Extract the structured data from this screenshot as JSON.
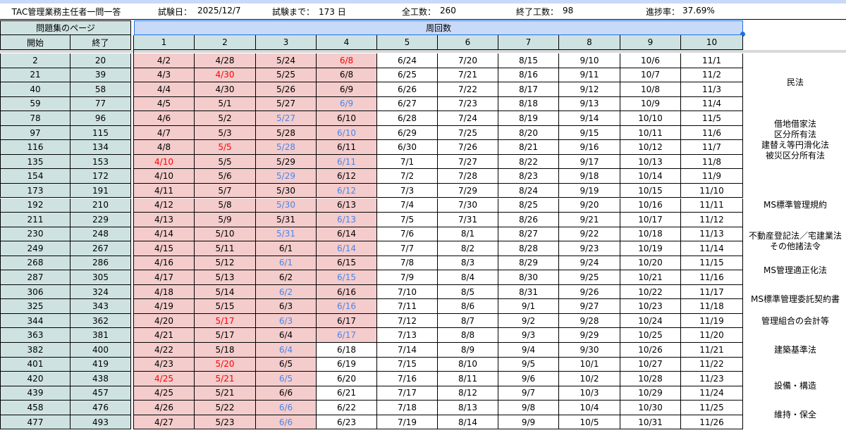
{
  "header": {
    "title": "TAC管理業務主任者一問一答",
    "exam_date_label": "試験日：",
    "exam_date": "2025/12/7",
    "days_left_label": "試験まで：",
    "days_left": "173 日",
    "total_label": "全工数：",
    "total": "260",
    "done_label": "終了工数：",
    "done": "98",
    "progress_label": "進捗率：",
    "progress": "37.69%"
  },
  "section_headers": {
    "pages": "問題集のページ",
    "rounds": "周回数",
    "start": "開始",
    "end": "終了"
  },
  "round_numbers": [
    "1",
    "2",
    "3",
    "4",
    "5",
    "6",
    "7",
    "8",
    "9",
    "10"
  ],
  "colors": {
    "red": "#ff0000",
    "blue": "#4a86e8",
    "pink": "#f4cccc",
    "teal": "#cfe2e2"
  },
  "rows": [
    {
      "start": "2",
      "end": "20",
      "dates": [
        "4/2",
        "4/28",
        "5/24",
        "6/8",
        "6/24",
        "7/20",
        "8/15",
        "9/10",
        "10/6",
        "11/1"
      ],
      "colors": [
        "k",
        "k",
        "k",
        "r",
        "k",
        "k",
        "k",
        "k",
        "k",
        "k"
      ]
    },
    {
      "start": "21",
      "end": "39",
      "dates": [
        "4/3",
        "4/30",
        "5/25",
        "6/8",
        "6/25",
        "7/21",
        "8/16",
        "9/11",
        "10/7",
        "11/2"
      ],
      "colors": [
        "k",
        "r",
        "k",
        "k",
        "k",
        "k",
        "k",
        "k",
        "k",
        "k"
      ]
    },
    {
      "start": "40",
      "end": "58",
      "dates": [
        "4/4",
        "4/30",
        "5/26",
        "6/9",
        "6/26",
        "7/22",
        "8/17",
        "9/12",
        "10/8",
        "11/3"
      ],
      "colors": [
        "k",
        "k",
        "k",
        "k",
        "k",
        "k",
        "k",
        "k",
        "k",
        "k"
      ]
    },
    {
      "start": "59",
      "end": "77",
      "dates": [
        "4/5",
        "5/1",
        "5/27",
        "6/9",
        "6/27",
        "7/23",
        "8/18",
        "9/13",
        "10/9",
        "11/4"
      ],
      "colors": [
        "k",
        "k",
        "k",
        "b",
        "k",
        "k",
        "k",
        "k",
        "k",
        "k"
      ]
    },
    {
      "start": "78",
      "end": "96",
      "dates": [
        "4/6",
        "5/2",
        "5/27",
        "6/10",
        "6/28",
        "7/24",
        "8/19",
        "9/14",
        "10/10",
        "11/5"
      ],
      "colors": [
        "k",
        "k",
        "b",
        "k",
        "k",
        "k",
        "k",
        "k",
        "k",
        "k"
      ]
    },
    {
      "start": "97",
      "end": "115",
      "dates": [
        "4/7",
        "5/3",
        "5/28",
        "6/10",
        "6/29",
        "7/25",
        "8/20",
        "9/15",
        "10/11",
        "11/6"
      ],
      "colors": [
        "k",
        "k",
        "k",
        "b",
        "k",
        "k",
        "k",
        "k",
        "k",
        "k"
      ]
    },
    {
      "start": "116",
      "end": "134",
      "dates": [
        "4/8",
        "5/5",
        "5/28",
        "6/11",
        "6/30",
        "7/26",
        "8/21",
        "9/16",
        "10/12",
        "11/7"
      ],
      "colors": [
        "k",
        "r",
        "b",
        "k",
        "k",
        "k",
        "k",
        "k",
        "k",
        "k"
      ]
    },
    {
      "start": "135",
      "end": "153",
      "dates": [
        "4/10",
        "5/5",
        "5/29",
        "6/11",
        "7/1",
        "7/27",
        "8/22",
        "9/17",
        "10/13",
        "11/8"
      ],
      "colors": [
        "r",
        "k",
        "k",
        "b",
        "k",
        "k",
        "k",
        "k",
        "k",
        "k"
      ]
    },
    {
      "start": "154",
      "end": "172",
      "dates": [
        "4/10",
        "5/6",
        "5/29",
        "6/12",
        "7/2",
        "7/28",
        "8/23",
        "9/18",
        "10/14",
        "11/9"
      ],
      "colors": [
        "k",
        "k",
        "b",
        "k",
        "k",
        "k",
        "k",
        "k",
        "k",
        "k"
      ]
    },
    {
      "start": "173",
      "end": "191",
      "dates": [
        "4/11",
        "5/7",
        "5/30",
        "6/12",
        "7/3",
        "7/29",
        "8/24",
        "9/19",
        "10/15",
        "11/10"
      ],
      "colors": [
        "k",
        "k",
        "k",
        "b",
        "k",
        "k",
        "k",
        "k",
        "k",
        "k"
      ]
    },
    {
      "start": "192",
      "end": "210",
      "dates": [
        "4/12",
        "5/8",
        "5/30",
        "6/13",
        "7/4",
        "7/30",
        "8/25",
        "9/20",
        "10/16",
        "11/11"
      ],
      "colors": [
        "k",
        "k",
        "b",
        "k",
        "k",
        "k",
        "k",
        "k",
        "k",
        "k"
      ]
    },
    {
      "start": "211",
      "end": "229",
      "dates": [
        "4/13",
        "5/9",
        "5/31",
        "6/13",
        "7/5",
        "7/31",
        "8/26",
        "9/21",
        "10/17",
        "11/12"
      ],
      "colors": [
        "k",
        "k",
        "k",
        "b",
        "k",
        "k",
        "k",
        "k",
        "k",
        "k"
      ]
    },
    {
      "start": "230",
      "end": "248",
      "dates": [
        "4/14",
        "5/10",
        "5/31",
        "6/14",
        "7/6",
        "8/1",
        "8/27",
        "9/22",
        "10/18",
        "11/13"
      ],
      "colors": [
        "k",
        "k",
        "b",
        "k",
        "k",
        "k",
        "k",
        "k",
        "k",
        "k"
      ]
    },
    {
      "start": "249",
      "end": "267",
      "dates": [
        "4/15",
        "5/11",
        "6/1",
        "6/14",
        "7/7",
        "8/2",
        "8/28",
        "9/23",
        "10/19",
        "11/14"
      ],
      "colors": [
        "k",
        "k",
        "k",
        "b",
        "k",
        "k",
        "k",
        "k",
        "k",
        "k"
      ]
    },
    {
      "start": "268",
      "end": "286",
      "dates": [
        "4/16",
        "5/12",
        "6/1",
        "6/15",
        "7/8",
        "8/3",
        "8/29",
        "9/24",
        "10/20",
        "11/15"
      ],
      "colors": [
        "k",
        "k",
        "b",
        "k",
        "k",
        "k",
        "k",
        "k",
        "k",
        "k"
      ]
    },
    {
      "start": "287",
      "end": "305",
      "dates": [
        "4/17",
        "5/13",
        "6/2",
        "6/15",
        "7/9",
        "8/4",
        "8/30",
        "9/25",
        "10/21",
        "11/16"
      ],
      "colors": [
        "k",
        "k",
        "k",
        "b",
        "k",
        "k",
        "k",
        "k",
        "k",
        "k"
      ]
    },
    {
      "start": "306",
      "end": "324",
      "dates": [
        "4/18",
        "5/14",
        "6/2",
        "6/16",
        "7/10",
        "8/5",
        "8/31",
        "9/26",
        "10/22",
        "11/17"
      ],
      "colors": [
        "k",
        "k",
        "b",
        "k",
        "k",
        "k",
        "k",
        "k",
        "k",
        "k"
      ]
    },
    {
      "start": "325",
      "end": "343",
      "dates": [
        "4/19",
        "5/15",
        "6/3",
        "6/16",
        "7/11",
        "8/6",
        "9/1",
        "9/27",
        "10/23",
        "11/18"
      ],
      "colors": [
        "k",
        "k",
        "k",
        "b",
        "k",
        "k",
        "k",
        "k",
        "k",
        "k"
      ]
    },
    {
      "start": "344",
      "end": "362",
      "dates": [
        "4/20",
        "5/17",
        "6/3",
        "6/17",
        "7/12",
        "8/7",
        "9/2",
        "9/28",
        "10/24",
        "11/19"
      ],
      "colors": [
        "k",
        "r",
        "b",
        "k",
        "k",
        "k",
        "k",
        "k",
        "k",
        "k"
      ]
    },
    {
      "start": "363",
      "end": "381",
      "dates": [
        "4/21",
        "5/17",
        "6/4",
        "6/17",
        "7/13",
        "8/8",
        "9/3",
        "9/29",
        "10/25",
        "11/20"
      ],
      "colors": [
        "k",
        "k",
        "k",
        "b",
        "k",
        "k",
        "k",
        "k",
        "k",
        "k"
      ]
    },
    {
      "start": "382",
      "end": "400",
      "dates": [
        "4/22",
        "5/18",
        "6/4",
        "6/18",
        "7/14",
        "8/9",
        "9/4",
        "9/30",
        "10/26",
        "11/21"
      ],
      "colors": [
        "k",
        "k",
        "b",
        "k",
        "k",
        "k",
        "k",
        "k",
        "k",
        "k"
      ]
    },
    {
      "start": "401",
      "end": "419",
      "dates": [
        "4/23",
        "5/20",
        "6/5",
        "6/19",
        "7/15",
        "8/10",
        "9/5",
        "10/1",
        "10/27",
        "11/22"
      ],
      "colors": [
        "k",
        "r",
        "k",
        "k",
        "k",
        "k",
        "k",
        "k",
        "k",
        "k"
      ]
    },
    {
      "start": "420",
      "end": "438",
      "dates": [
        "4/25",
        "5/21",
        "6/5",
        "6/20",
        "7/16",
        "8/11",
        "9/6",
        "10/2",
        "10/28",
        "11/23"
      ],
      "colors": [
        "r",
        "r",
        "b",
        "k",
        "k",
        "k",
        "k",
        "k",
        "k",
        "k"
      ]
    },
    {
      "start": "439",
      "end": "457",
      "dates": [
        "4/25",
        "5/21",
        "6/6",
        "6/21",
        "7/17",
        "8/12",
        "9/7",
        "10/3",
        "10/29",
        "11/24"
      ],
      "colors": [
        "k",
        "k",
        "k",
        "k",
        "k",
        "k",
        "k",
        "k",
        "k",
        "k"
      ]
    },
    {
      "start": "458",
      "end": "476",
      "dates": [
        "4/26",
        "5/22",
        "6/6",
        "6/22",
        "7/18",
        "8/13",
        "9/8",
        "10/4",
        "10/30",
        "11/25"
      ],
      "colors": [
        "k",
        "k",
        "b",
        "k",
        "k",
        "k",
        "k",
        "k",
        "k",
        "k"
      ]
    },
    {
      "start": "477",
      "end": "493",
      "dates": [
        "4/27",
        "5/23",
        "6/6",
        "6/23",
        "7/19",
        "8/14",
        "9/9",
        "10/5",
        "10/31",
        "11/26"
      ],
      "colors": [
        "k",
        "k",
        "b",
        "k",
        "k",
        "k",
        "k",
        "k",
        "k",
        "k"
      ]
    }
  ],
  "pink_through_row": [
    8,
    20,
    20,
    20
  ],
  "pink_extra": {
    "col1_rows": 26,
    "col2_rows": 26,
    "col3_rows": 26,
    "col4_rows": 20
  },
  "side_labels": [
    {
      "text": "民法",
      "row_start": 0,
      "row_span": 4
    },
    {
      "text": "借地借家法\n区分所有法\n建替え等円滑化法\n被災区分所有法",
      "row_start": 4,
      "row_span": 4
    },
    {
      "text": "MS標準管理規約",
      "row_start": 8,
      "row_span": 5
    },
    {
      "text": "不動産登記法／宅建業法\nその他諸法令",
      "row_start": 12,
      "row_span": 2
    },
    {
      "text": "MS管理適正化法",
      "row_start": 14,
      "row_span": 2
    },
    {
      "text": "MS標準管理委託契約書",
      "row_start": 16,
      "row_span": 2
    },
    {
      "text": "管理組合の会計等",
      "row_start": 18,
      "row_span": 1
    },
    {
      "text": "建築基準法",
      "row_start": 19,
      "row_span": 3
    },
    {
      "text": "設備・構造",
      "row_start": 22,
      "row_span": 2
    },
    {
      "text": "維持・保全",
      "row_start": 24,
      "row_span": 2
    }
  ]
}
